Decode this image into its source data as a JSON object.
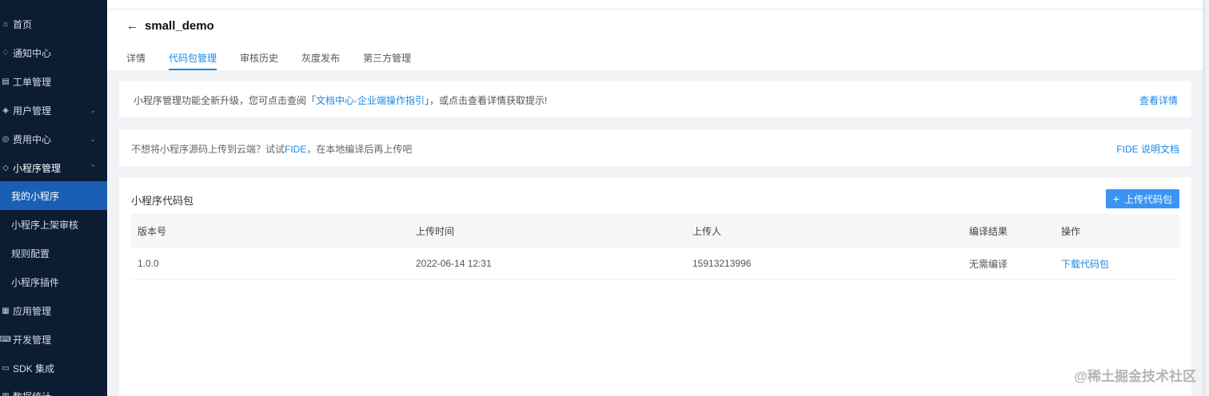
{
  "sidebar": {
    "items": [
      {
        "label": "首页",
        "icon": "home-icon",
        "glyph": "⌂",
        "expandable": false
      },
      {
        "label": "通知中心",
        "icon": "bell-icon",
        "glyph": "♢",
        "expandable": false
      },
      {
        "label": "工单管理",
        "icon": "document-icon",
        "glyph": "▤",
        "expandable": false
      },
      {
        "label": "用户管理",
        "icon": "layers-icon",
        "glyph": "◈",
        "expandable": true
      },
      {
        "label": "费用中心",
        "icon": "coin-icon",
        "glyph": "◎",
        "expandable": true
      },
      {
        "label": "小程序管理",
        "icon": "diamond-icon",
        "glyph": "◇",
        "expandable": true,
        "open": true
      },
      {
        "label": "我的小程序",
        "sub": true,
        "active": true
      },
      {
        "label": "小程序上架审核",
        "sub": true
      },
      {
        "label": "规则配置",
        "sub": true
      },
      {
        "label": "小程序插件",
        "sub": true
      },
      {
        "label": "应用管理",
        "icon": "grid-icon",
        "glyph": "▦",
        "expandable": false
      },
      {
        "label": "开发管理",
        "icon": "code-icon",
        "glyph": "⌨",
        "expandable": false
      },
      {
        "label": "SDK 集成",
        "icon": "sdk-icon",
        "glyph": "▭",
        "expandable": false
      },
      {
        "label": "数据统计",
        "icon": "chart-icon",
        "glyph": "▥",
        "expandable": true
      }
    ],
    "chevron_down": "⌄",
    "chevron_up": "⌃"
  },
  "header": {
    "back_glyph": "←",
    "title": "small_demo",
    "tabs": [
      {
        "label": "详情",
        "active": false
      },
      {
        "label": "代码包管理",
        "active": true
      },
      {
        "label": "审核历史",
        "active": false
      },
      {
        "label": "灰度发布",
        "active": false
      },
      {
        "label": "第三方管理",
        "active": false
      }
    ]
  },
  "notice1": {
    "prefix": "小程序管理功能全新升级，您可点击查阅「",
    "link": "文档中心-企业端操作指引",
    "suffix": "」，或点击查看详情获取提示!",
    "action": "查看详情"
  },
  "notice2": {
    "prefix": "不想将小程序源码上传到云端？试试",
    "fide": "FIDE",
    "suffix": "，在本地编译后再上传吧",
    "action": "FIDE 说明文档"
  },
  "panel": {
    "title": "小程序代码包",
    "upload_button": "上传代码包",
    "upload_glyph": "+",
    "columns": [
      "版本号",
      "上传时间",
      "上传人",
      "编译结果",
      "操作"
    ],
    "rows": [
      {
        "version": "1.0.0",
        "time": "2022-06-14 12:31",
        "uploader": "15913213996",
        "result": "无需编译",
        "action": "下载代码包"
      }
    ]
  },
  "watermark": "@稀土掘金技术社区",
  "colors": {
    "sidebar_bg": "#0b1c33",
    "active_bg": "#1a5fb4",
    "accent": "#1a88e6",
    "button": "#3a95f2"
  }
}
